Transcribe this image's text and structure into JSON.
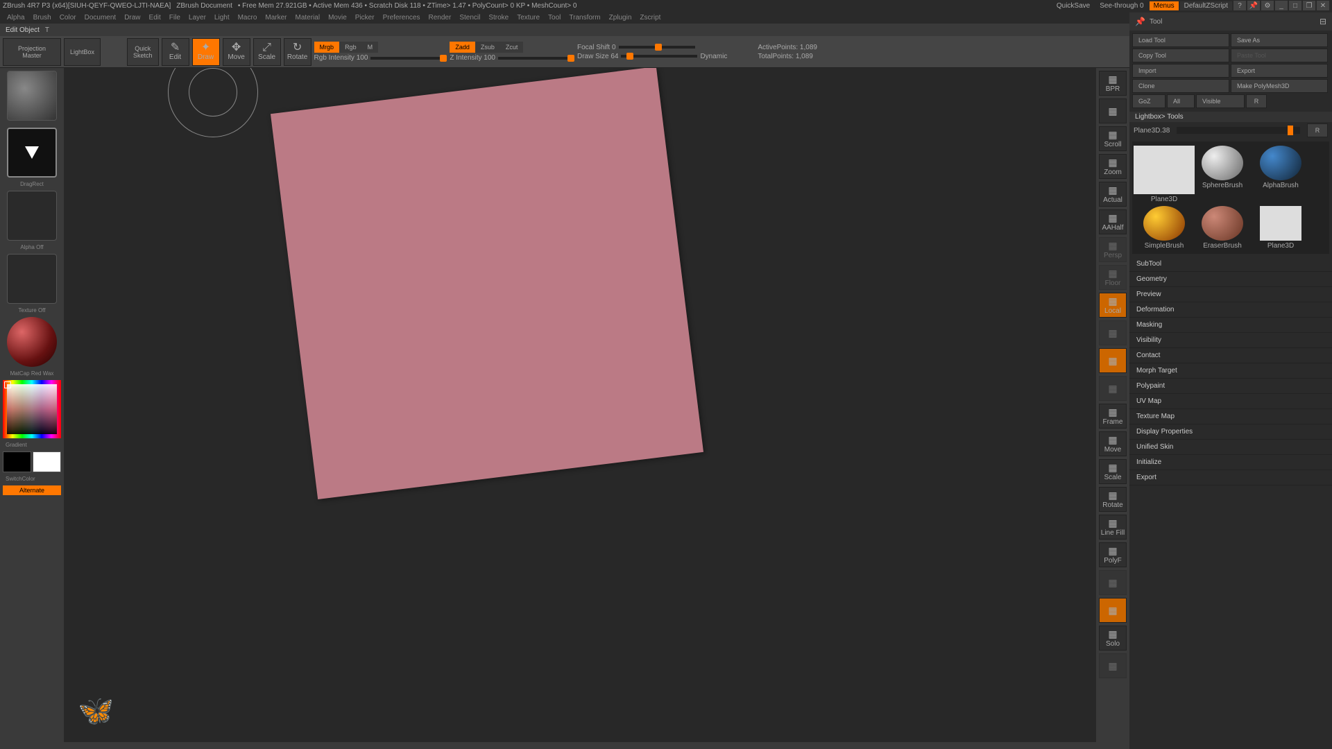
{
  "domain": "Computer-Use",
  "titlebar": {
    "app": "ZBrush 4R7 P3 (x64)[SIUH-QEYF-QWEO-LJTI-NAEA]",
    "doc": "ZBrush Document",
    "stats": "• Free Mem 27.921GB • Active Mem 436 • Scratch Disk 118 • ZTime> 1.47 • PolyCount> 0 KP • MeshCount> 0",
    "quicksave": "QuickSave",
    "seethrough": "See-through   0",
    "menus": "Menus",
    "script": "DefaultZScript"
  },
  "menubar": [
    "Alpha",
    "Brush",
    "Color",
    "Document",
    "Draw",
    "Edit",
    "File",
    "Layer",
    "Light",
    "Macro",
    "Marker",
    "Material",
    "Movie",
    "Picker",
    "Preferences",
    "Render",
    "Stencil",
    "Stroke",
    "Texture",
    "Tool",
    "Transform",
    "Zplugin",
    "Zscript"
  ],
  "infobar": {
    "label": "Edit Object",
    "key": "T"
  },
  "toolbar": {
    "projection": "Projection\nMaster",
    "lightbox": "LightBox",
    "quicksketch": "Quick\nSketch",
    "edit": "Edit",
    "draw": "Draw",
    "move": "Move",
    "scale": "Scale",
    "rotate": "Rotate",
    "mrgb": "Mrgb",
    "rgb": "Rgb",
    "m": "M",
    "zadd": "Zadd",
    "zsub": "Zsub",
    "zcut": "Zcut",
    "rgbint": "Rgb Intensity 100",
    "zint": "Z Intensity 100",
    "focal": "Focal Shift 0",
    "drawsize": "Draw Size 64",
    "dynamic": "Dynamic",
    "activepts": "ActivePoints: 1,089",
    "totalpts": "TotalPoints: 1,089"
  },
  "left": {
    "brush": "",
    "dragrect": "DragRect",
    "alpha": "Alpha Off",
    "texture": "Texture Off",
    "material": "MatCap Red Wax",
    "gradient": "Gradient",
    "switchcolor": "SwitchColor",
    "alternate": "Alternate"
  },
  "iconstrip": [
    {
      "name": "bpr",
      "label": "BPR"
    },
    {
      "name": "divider",
      "label": ""
    },
    {
      "name": "scroll",
      "label": "Scroll"
    },
    {
      "name": "zoom",
      "label": "Zoom"
    },
    {
      "name": "actual",
      "label": "Actual"
    },
    {
      "name": "aahalf",
      "label": "AAHalf"
    },
    {
      "name": "persp",
      "label": "Persp",
      "dim": true
    },
    {
      "name": "floor",
      "label": "Floor",
      "dim": true
    },
    {
      "name": "local",
      "label": "Local",
      "active": true
    },
    {
      "name": "localsym",
      "label": "",
      "dim": true
    },
    {
      "name": "lcam",
      "label": "",
      "active": true
    },
    {
      "name": "xpose",
      "label": "",
      "dim": true
    },
    {
      "name": "frame",
      "label": "Frame"
    },
    {
      "name": "move2",
      "label": "Move"
    },
    {
      "name": "scale2",
      "label": "Scale"
    },
    {
      "name": "rotate2",
      "label": "Rotate"
    },
    {
      "name": "linefill",
      "label": "Line Fill"
    },
    {
      "name": "polyf",
      "label": "PolyF"
    },
    {
      "name": "transp",
      "label": "",
      "dim": true
    },
    {
      "name": "ghost",
      "label": "",
      "active": true
    },
    {
      "name": "solo",
      "label": "Solo"
    },
    {
      "name": "xpose2",
      "label": "",
      "dim": true
    }
  ],
  "tool": {
    "title": "Tool",
    "load": "Load Tool",
    "save": "Save As",
    "copy": "Copy Tool",
    "paste": "Paste Tool",
    "import": "Import",
    "export": "Export",
    "clone": "Clone",
    "makepm": "Make PolyMesh3D",
    "goz": "GoZ",
    "all": "All",
    "visible": "Visible",
    "r": "R",
    "lightbox": "Lightbox> Tools",
    "current": "Plane3D.38",
    "r2": "R",
    "thumbs": [
      {
        "name": "plane3d",
        "label": "Plane3D"
      },
      {
        "name": "spherebrush",
        "label": "SphereBrush"
      },
      {
        "name": "alphabrush",
        "label": "AlphaBrush"
      },
      {
        "name": "simplebrush",
        "label": "SimpleBrush"
      },
      {
        "name": "eraserbrush",
        "label": "EraserBrush"
      },
      {
        "name": "plane3d2",
        "label": "Plane3D"
      }
    ],
    "sections": [
      "SubTool",
      "Geometry",
      "Preview",
      "Deformation",
      "Masking",
      "Visibility",
      "Contact",
      "Morph Target",
      "Polypaint",
      "UV Map",
      "Texture Map",
      "Display Properties",
      "Unified Skin",
      "Initialize",
      "Export"
    ]
  }
}
